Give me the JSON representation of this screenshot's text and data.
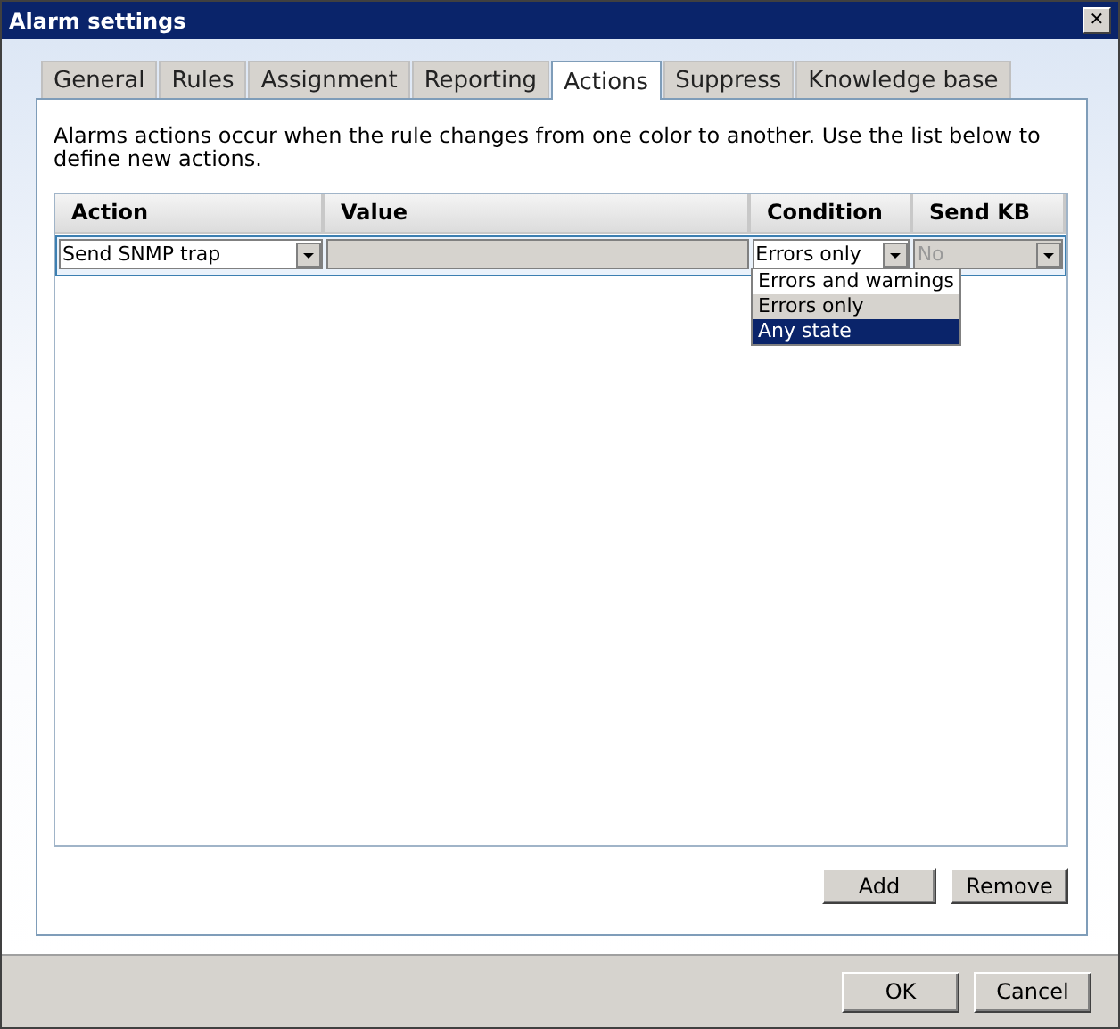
{
  "window": {
    "title": "Alarm settings",
    "close": "✕"
  },
  "tabs": [
    {
      "label": "General",
      "selected": false
    },
    {
      "label": "Rules",
      "selected": false
    },
    {
      "label": "Assignment",
      "selected": false
    },
    {
      "label": "Reporting",
      "selected": false
    },
    {
      "label": "Actions",
      "selected": true
    },
    {
      "label": "Suppress",
      "selected": false
    },
    {
      "label": "Knowledge base",
      "selected": false
    }
  ],
  "description": "Alarms actions occur when the rule changes from one color to another. Use the list below to define new actions.",
  "table": {
    "columns": [
      "Action",
      "Value",
      "Condition",
      "Send KB"
    ],
    "rows": [
      {
        "action": "Send SNMP trap",
        "value": "",
        "condition": "Errors only",
        "send_kb": "No",
        "send_kb_disabled": true
      }
    ]
  },
  "condition_menu": [
    {
      "label": "Errors and warnings",
      "selected": false,
      "current": false
    },
    {
      "label": "Errors only",
      "selected": false,
      "current": true
    },
    {
      "label": "Any state",
      "selected": true,
      "current": false
    }
  ],
  "list_buttons": [
    "Add",
    "Remove"
  ],
  "buttons": [
    "OK",
    "Cancel"
  ]
}
